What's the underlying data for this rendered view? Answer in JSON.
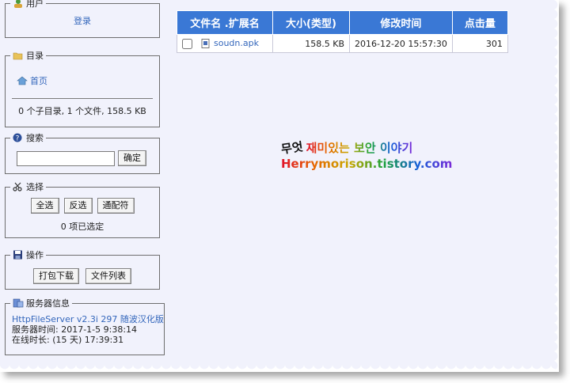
{
  "sidebar": {
    "user": {
      "legend": "用户",
      "login": "登录"
    },
    "directory": {
      "legend": "目录",
      "home": "首页",
      "summary": "0 个子目录, 1 个文件, 158.5 KB"
    },
    "search": {
      "legend": "搜索",
      "input_value": "",
      "button": "确定"
    },
    "select": {
      "legend": "选择",
      "buttons": [
        "全选",
        "反选",
        "通配符"
      ],
      "status": "0 项已选定"
    },
    "actions": {
      "legend": "操作",
      "buttons": [
        "打包下载",
        "文件列表"
      ]
    },
    "server": {
      "legend": "服务器信息",
      "version_link": "HttpFileServer v2.3i 297 随波汉化版",
      "server_time": "服务器时间: 2017-1-5 9:38:14",
      "uptime": "在线时长: (15 天) 17:39:31"
    }
  },
  "files": {
    "headers": [
      "文件名 .扩展名",
      "大小(类型)",
      "修改时间",
      "点击量"
    ],
    "rows": [
      {
        "name": "soudn.apk",
        "size": "158.5 KB",
        "modified": "2016-12-20 15:57:30",
        "hits": "301"
      }
    ]
  },
  "watermark": {
    "line1": "재미있는 보안 이야기",
    "line2": "Herrymorison.tistory.com",
    "logo_text": "무엇"
  },
  "colors": {
    "header_bg": "#3a78d5",
    "page_bg": "#f1f2fc",
    "link": "#3366bb"
  }
}
